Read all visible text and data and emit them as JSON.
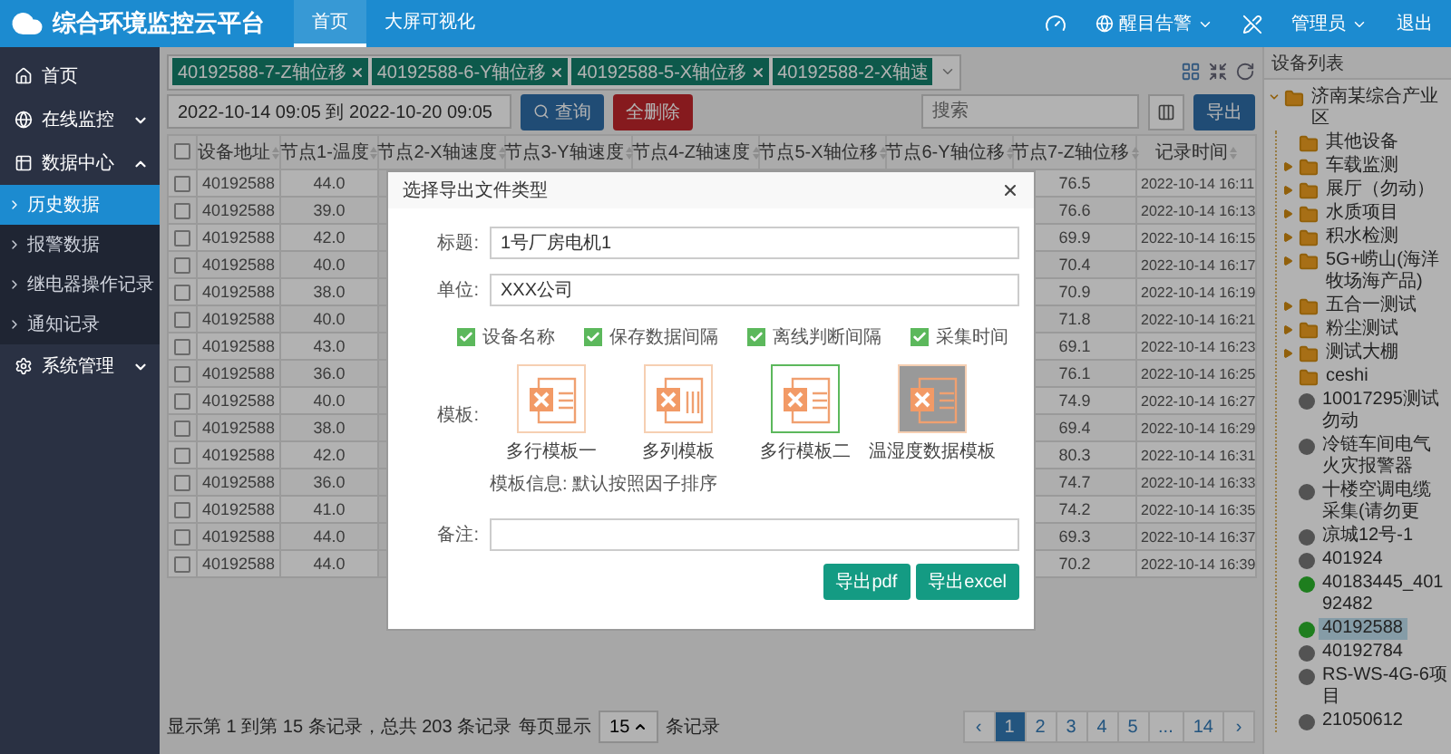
{
  "header": {
    "title": "综合环境监控云平台",
    "nav": [
      {
        "label": "首页",
        "selected": true
      },
      {
        "label": "大屏可视化",
        "selected": false
      }
    ],
    "alarm": "醒目告警",
    "user": "管理员",
    "logout": "退出"
  },
  "sidebar": {
    "items": [
      {
        "label": "首页"
      },
      {
        "label": "在线监控",
        "expanded": false
      },
      {
        "label": "数据中心",
        "expanded": true,
        "children": [
          {
            "label": "历史数据",
            "selected": true
          },
          {
            "label": "报警数据",
            "selected": false
          },
          {
            "label": "继电器操作记录",
            "selected": false
          },
          {
            "label": "通知记录",
            "selected": false
          }
        ]
      },
      {
        "label": "系统管理",
        "expanded": false
      }
    ]
  },
  "filters": {
    "tags": [
      "40192588-7-Z轴位移",
      "40192588-6-Y轴位移",
      "40192588-5-X轴位移",
      "40192588-2-X轴速"
    ],
    "date_range": "2022-10-14 09:05 到 2022-10-20 09:05",
    "query_button": "查询",
    "delete_button": "全删除",
    "search_placeholder": "搜索",
    "export_button": "导出"
  },
  "table": {
    "select_all": false,
    "columns": [
      "设备地址",
      "节点1-温度",
      "节点2-X轴速度",
      "节点3-Y轴速度",
      "节点4-Z轴速度",
      "节点5-X轴位移",
      "节点6-Y轴位移",
      "节点7-Z轴位移",
      "记录时间"
    ],
    "rows": [
      {
        "checked": false,
        "address": "40192588",
        "temp": "44.0",
        "z_disp": "76.5",
        "time": "2022-10-14 16:11"
      },
      {
        "checked": false,
        "address": "40192588",
        "temp": "39.0",
        "z_disp": "76.6",
        "time": "2022-10-14 16:13"
      },
      {
        "checked": false,
        "address": "40192588",
        "temp": "42.0",
        "z_disp": "69.9",
        "time": "2022-10-14 16:15"
      },
      {
        "checked": false,
        "address": "40192588",
        "temp": "40.0",
        "z_disp": "70.4",
        "time": "2022-10-14 16:17"
      },
      {
        "checked": false,
        "address": "40192588",
        "temp": "38.0",
        "z_disp": "70.9",
        "time": "2022-10-14 16:19"
      },
      {
        "checked": false,
        "address": "40192588",
        "temp": "40.0",
        "z_disp": "71.8",
        "time": "2022-10-14 16:21"
      },
      {
        "checked": false,
        "address": "40192588",
        "temp": "43.0",
        "z_disp": "69.1",
        "time": "2022-10-14 16:23"
      },
      {
        "checked": false,
        "address": "40192588",
        "temp": "36.0",
        "z_disp": "76.1",
        "time": "2022-10-14 16:25"
      },
      {
        "checked": false,
        "address": "40192588",
        "temp": "40.0",
        "z_disp": "74.9",
        "time": "2022-10-14 16:27"
      },
      {
        "checked": false,
        "address": "40192588",
        "temp": "38.0",
        "z_disp": "69.4",
        "time": "2022-10-14 16:29"
      },
      {
        "checked": false,
        "address": "40192588",
        "temp": "42.0",
        "z_disp": "80.3",
        "time": "2022-10-14 16:31"
      },
      {
        "checked": false,
        "address": "40192588",
        "temp": "36.0",
        "z_disp": "74.7",
        "time": "2022-10-14 16:33"
      },
      {
        "checked": false,
        "address": "40192588",
        "temp": "41.0",
        "z_disp": "74.2",
        "time": "2022-10-14 16:35"
      },
      {
        "checked": false,
        "address": "40192588",
        "temp": "44.0",
        "z_disp": "69.3",
        "time": "2022-10-14 16:37"
      },
      {
        "checked": false,
        "address": "40192588",
        "temp": "44.0",
        "z_disp": "70.2",
        "time": "2022-10-14 16:39"
      }
    ]
  },
  "pagination": {
    "summary": "显示第 1 到第 15 条记录，总共 203 条记录",
    "per_page_label": "每页显示",
    "per_page": "15",
    "per_page_suffix": "条记录",
    "pages": [
      {
        "label": "‹",
        "selected": false
      },
      {
        "label": "1",
        "selected": true
      },
      {
        "label": "2",
        "selected": false
      },
      {
        "label": "3",
        "selected": false
      },
      {
        "label": "4",
        "selected": false
      },
      {
        "label": "5",
        "selected": false
      },
      {
        "label": "...",
        "selected": false
      },
      {
        "label": "14",
        "selected": false
      },
      {
        "label": "›",
        "selected": false
      }
    ]
  },
  "device_panel": {
    "title": "设备列表",
    "tree": [
      {
        "label": "济南某综合产业区",
        "kind": "folder",
        "expanded": true,
        "children": [
          {
            "label": "其他设备",
            "kind": "folder"
          },
          {
            "label": "车载监测",
            "kind": "folder",
            "expanded": false
          },
          {
            "label": "展厅（勿动）",
            "kind": "folder",
            "expanded": false
          },
          {
            "label": "水质项目",
            "kind": "folder",
            "expanded": false
          },
          {
            "label": "积水检测",
            "kind": "folder",
            "expanded": false
          },
          {
            "label": "5G+崂山(海洋牧场海产品)",
            "kind": "folder",
            "expanded": false
          },
          {
            "label": "五合一测试",
            "kind": "folder",
            "expanded": false
          },
          {
            "label": "粉尘测试",
            "kind": "folder",
            "expanded": false
          },
          {
            "label": "测试大棚",
            "kind": "folder",
            "expanded": false
          },
          {
            "label": "ceshi",
            "kind": "folder"
          },
          {
            "label": "10017295测试勿动",
            "kind": "device",
            "online": false,
            "selected": false
          },
          {
            "label": "冷链车间电气火灾报警器",
            "kind": "device",
            "online": false,
            "selected": false
          },
          {
            "label": "十楼空调电缆采集(请勿更",
            "kind": "device",
            "online": false,
            "selected": false
          },
          {
            "label": "凉城12号-1",
            "kind": "device",
            "online": false,
            "selected": false
          },
          {
            "label": "401924",
            "kind": "device",
            "online": false,
            "selected": false
          },
          {
            "label": "40183445_40192482",
            "kind": "device",
            "online": true,
            "selected": false
          },
          {
            "label": "40192588",
            "kind": "device",
            "online": true,
            "selected": true
          },
          {
            "label": "40192784",
            "kind": "device",
            "online": false,
            "selected": false
          },
          {
            "label": "RS-WS-4G-6项目",
            "kind": "device",
            "online": false,
            "selected": false
          },
          {
            "label": "21050612",
            "kind": "device",
            "online": false,
            "selected": false
          }
        ]
      }
    ]
  },
  "export_dialog": {
    "title": "选择导出文件类型",
    "fields": [
      {
        "label": "标题:",
        "value": "1号厂房电机1"
      },
      {
        "label": "单位:",
        "value": "XXX公司"
      }
    ],
    "options": [
      {
        "label": "设备名称",
        "checked": true
      },
      {
        "label": "保存数据间隔",
        "checked": true
      },
      {
        "label": "离线判断间隔",
        "checked": true
      },
      {
        "label": "采集时间",
        "checked": true
      }
    ],
    "template_label": "模板:",
    "templates": [
      {
        "name": "多行模板一",
        "kind": "rows",
        "selected": false,
        "disabled": false
      },
      {
        "name": "多列模板",
        "kind": "columns",
        "selected": false,
        "disabled": false
      },
      {
        "name": "多行模板二",
        "kind": "rows",
        "selected": true,
        "disabled": false
      },
      {
        "name": "温湿度数据模板",
        "kind": "rows",
        "selected": false,
        "disabled": true
      }
    ],
    "template_info": "模板信息: 默认按照因子排序",
    "note_label": "备注:",
    "buttons": [
      "导出pdf",
      "导出excel"
    ]
  }
}
